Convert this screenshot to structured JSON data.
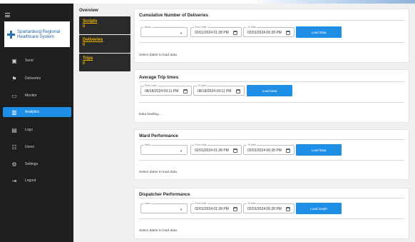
{
  "sidebar": {
    "logo_text_line1": "Spartanburg Regional",
    "logo_text_line2": "Healthcare System",
    "items": [
      {
        "label": "Send",
        "icon": "send-icon"
      },
      {
        "label": "Deliveries",
        "icon": "deliveries-icon"
      },
      {
        "label": "Monitor",
        "icon": "monitor-icon"
      },
      {
        "label": "Analytics",
        "icon": "analytics-icon",
        "active": true
      },
      {
        "label": "Logs",
        "icon": "logs-icon"
      },
      {
        "label": "Users",
        "icon": "users-icon"
      },
      {
        "label": "Settings",
        "icon": "settings-icon"
      },
      {
        "label": "Logout",
        "icon": "logout-icon"
      }
    ],
    "accent_color": "#1f8fe6"
  },
  "overview": {
    "title": "Overview",
    "stats": [
      {
        "label": "Scripts",
        "value": "0"
      },
      {
        "label": "Deliveries",
        "value": "0"
      },
      {
        "label": "Trips",
        "value": "0"
      }
    ]
  },
  "panels": {
    "cumulative": {
      "title": "Cumulative Number of Deliveries",
      "select_label": "Binss",
      "from_label": "From Date",
      "from_value": "02/01/2024 01:28 PM",
      "to_label": "To Date",
      "to_value": "02/01/2024 06:28 PM",
      "button": "Load Data",
      "status": "Select dates to load data."
    },
    "trip": {
      "title": "Average Trip times",
      "from_label": "From Date",
      "from_value": "08/18/2024 09:11 PM",
      "to_label": "To Date",
      "to_value": "08/18/2024 09:11 PM",
      "button": "Load Data",
      "status": "Data loading..."
    },
    "ward": {
      "title": "Ward Performance",
      "select_label": "Ward",
      "from_label": "From Date",
      "from_value": "02/01/2024 01:28 PM",
      "to_label": "To Date",
      "to_value": "02/01/2024 06:28 PM",
      "button": "Load Data",
      "status": "Select dates to load data."
    },
    "dispatcher": {
      "title": "Dispatcher Performance",
      "select_label": "User",
      "from_label": "From Date",
      "from_value": "02/01/2024 01:28 PM",
      "to_label": "To Date",
      "to_value": "02/01/2024 06:28 PM",
      "button": "Load Graph",
      "status": "Select dates to load data."
    }
  }
}
